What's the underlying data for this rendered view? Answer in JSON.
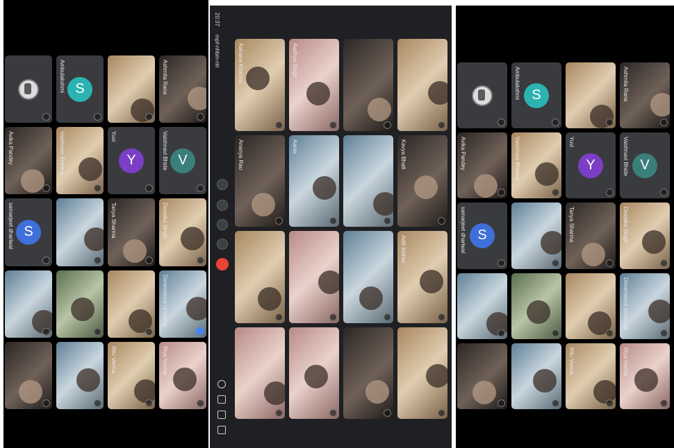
{
  "panels": {
    "left": {
      "tiles": [
        {
          "kind": "logo",
          "name": ""
        },
        {
          "kind": "avatar",
          "letter": "S",
          "color": "#2bb3b1",
          "name": "Ambulakshmi"
        },
        {
          "kind": "photo",
          "tone": "warm",
          "name": ""
        },
        {
          "kind": "photo",
          "tone": "dark",
          "name": "Ashmita Rana"
        },
        {
          "kind": "photo",
          "tone": "dark",
          "name": "Avika Pandey"
        },
        {
          "kind": "photo",
          "tone": "warm",
          "name": "Vaishnavi Bhimraj"
        },
        {
          "kind": "avatar",
          "letter": "Y",
          "color": "#7b3fc6",
          "name": "Yuvi"
        },
        {
          "kind": "avatar",
          "letter": "V",
          "color": "#3a7f7a",
          "name": "Vaishnavi Bhide"
        },
        {
          "kind": "avatar",
          "letter": "S",
          "color": "#3f6fd8",
          "name": "samarjeet dhariwal"
        },
        {
          "kind": "photo",
          "tone": "cool",
          "name": ""
        },
        {
          "kind": "photo",
          "tone": "dark",
          "name": "Tanya Sharma"
        },
        {
          "kind": "photo",
          "tone": "warm",
          "name": "Deepika Singh"
        },
        {
          "kind": "photo",
          "tone": "cool",
          "name": ""
        },
        {
          "kind": "photo",
          "tone": "green",
          "name": ""
        },
        {
          "kind": "photo",
          "tone": "warm",
          "name": ""
        },
        {
          "kind": "photo",
          "tone": "cool",
          "name": "Dimensions Universe",
          "pinned": true
        },
        {
          "kind": "photo",
          "tone": "dark",
          "name": ""
        },
        {
          "kind": "photo",
          "tone": "cool",
          "name": ""
        },
        {
          "kind": "photo",
          "tone": "warm",
          "name": "Ritu Verma"
        },
        {
          "kind": "photo",
          "tone": "pink",
          "name": "Riya Verma"
        }
      ]
    },
    "middle": {
      "clock": "20:37",
      "meeting_label": "mpf-nhbm-riri",
      "tiles": [
        {
          "kind": "photo",
          "tone": "warm",
          "name": "Aahana Khanna"
        },
        {
          "kind": "photo",
          "tone": "pink",
          "name": "Aadhya Singh"
        },
        {
          "kind": "photo",
          "tone": "dark",
          "name": ""
        },
        {
          "kind": "photo",
          "tone": "warm",
          "name": ""
        },
        {
          "kind": "photo",
          "tone": "dark",
          "name": "Ananya Rao"
        },
        {
          "kind": "photo",
          "tone": "cool",
          "name": "Aarav"
        },
        {
          "kind": "photo",
          "tone": "cool",
          "name": ""
        },
        {
          "kind": "photo",
          "tone": "dark",
          "name": "Kavya Bhatt"
        },
        {
          "kind": "photo",
          "tone": "warm",
          "name": ""
        },
        {
          "kind": "photo",
          "tone": "pink",
          "name": ""
        },
        {
          "kind": "photo",
          "tone": "cool",
          "name": ""
        },
        {
          "kind": "photo",
          "tone": "warm",
          "name": "Aditi Mehta"
        },
        {
          "kind": "photo",
          "tone": "pink",
          "name": ""
        },
        {
          "kind": "photo",
          "tone": "pink",
          "name": ""
        },
        {
          "kind": "photo",
          "tone": "dark",
          "name": ""
        },
        {
          "kind": "photo",
          "tone": "warm",
          "name": ""
        }
      ]
    },
    "right": {
      "tiles": [
        {
          "kind": "logo",
          "name": ""
        },
        {
          "kind": "avatar",
          "letter": "S",
          "color": "#2bb3b1",
          "name": "Ambulakshmi"
        },
        {
          "kind": "photo",
          "tone": "warm",
          "name": ""
        },
        {
          "kind": "photo",
          "tone": "dark",
          "name": "Ashmita Rana"
        },
        {
          "kind": "photo",
          "tone": "dark",
          "name": "Avika Pandey"
        },
        {
          "kind": "photo",
          "tone": "warm",
          "name": "Vaishnavi Bhimraj"
        },
        {
          "kind": "avatar",
          "letter": "Y",
          "color": "#7b3fc6",
          "name": "Yuvi"
        },
        {
          "kind": "avatar",
          "letter": "V",
          "color": "#3a7f7a",
          "name": "Vaishnavi Bhide"
        },
        {
          "kind": "avatar",
          "letter": "S",
          "color": "#3f6fd8",
          "name": "samarjeet dhariwal"
        },
        {
          "kind": "photo",
          "tone": "cool",
          "name": ""
        },
        {
          "kind": "photo",
          "tone": "dark",
          "name": "Tanya Sharma"
        },
        {
          "kind": "photo",
          "tone": "warm",
          "name": "Deepika Singh"
        },
        {
          "kind": "photo",
          "tone": "cool",
          "name": ""
        },
        {
          "kind": "photo",
          "tone": "green",
          "name": ""
        },
        {
          "kind": "photo",
          "tone": "warm",
          "name": ""
        },
        {
          "kind": "photo",
          "tone": "cool",
          "name": "Dimensions Universe"
        },
        {
          "kind": "photo",
          "tone": "dark",
          "name": ""
        },
        {
          "kind": "photo",
          "tone": "cool",
          "name": ""
        },
        {
          "kind": "photo",
          "tone": "warm",
          "name": "Ritu Verma"
        },
        {
          "kind": "photo",
          "tone": "pink",
          "name": "Riya Verma"
        }
      ]
    }
  },
  "controls": {
    "icons": [
      "mic-icon",
      "camera-icon",
      "present-icon",
      "more-icon",
      "end-call-icon"
    ],
    "end_call_color": "#ea4335",
    "side_icons": [
      "info-icon",
      "people-icon",
      "chat-icon",
      "activities-icon"
    ]
  }
}
